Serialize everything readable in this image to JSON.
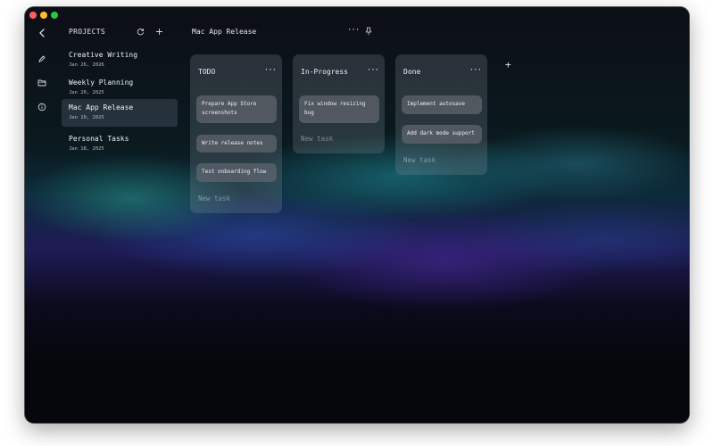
{
  "window": {
    "traffic_lights": [
      "close",
      "minimize",
      "zoom"
    ]
  },
  "sidebar_icons": [
    "chevron-left-icon",
    "pen-icon",
    "folder-icon",
    "info-icon"
  ],
  "projects_panel": {
    "header": "PROJECTS",
    "refresh_icon": "refresh-icon",
    "add_icon": "plus-icon",
    "items": [
      {
        "name": "Creative Writing",
        "date": "Jan 26, 2026",
        "selected": false
      },
      {
        "name": "Weekly Planning",
        "date": "Jan 20, 2025",
        "selected": false
      },
      {
        "name": "Mac App Release",
        "date": "Jan 19, 2025",
        "selected": true
      },
      {
        "name": "Personal Tasks",
        "date": "Jan 18, 2025",
        "selected": false
      }
    ]
  },
  "board": {
    "title": "Mac App Release",
    "menu_icon": "ellipsis-icon",
    "pin_icon": "pin-icon",
    "add_column_label": "+",
    "columns": [
      {
        "title": "TODO",
        "menu": "···",
        "cards": [
          "Prepare App Store screenshots",
          "Write release notes",
          "Test onboarding flow"
        ],
        "new_task": "New task"
      },
      {
        "title": "In-Progress",
        "menu": "···",
        "cards": [
          "Fix window resizing bug"
        ],
        "new_task": "New task"
      },
      {
        "title": "Done",
        "menu": "···",
        "cards": [
          "Implement autosave",
          "Add dark mode support"
        ],
        "new_task": "New task"
      }
    ]
  },
  "colors": {
    "close": "#fe5f57",
    "minimize": "#febc2e",
    "zoom": "#28c840",
    "window_bg": "#05070c"
  }
}
